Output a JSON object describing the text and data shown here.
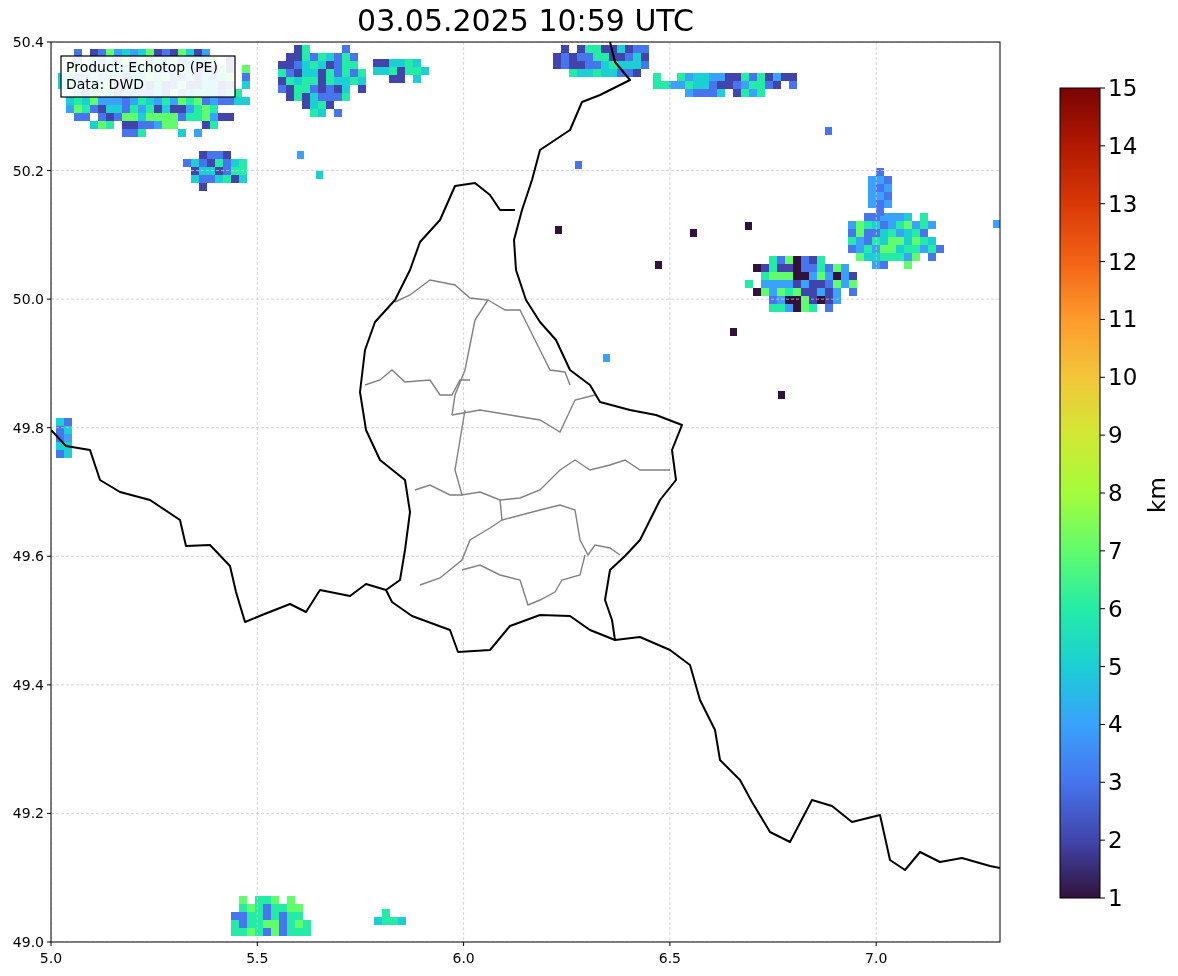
{
  "title": "03.05.2025 10:59 UTC",
  "info_box": {
    "lines": [
      "Product: Echotop (PE)",
      "Data: DWD"
    ]
  },
  "map": {
    "x_ticks": [
      "5.0",
      "5.5",
      "6.0",
      "6.5",
      "7.0"
    ],
    "y_ticks": [
      "50.4",
      "50.2",
      "50.0",
      "49.8",
      "49.6",
      "49.4",
      "49.2",
      "49.0"
    ]
  },
  "colorbar": {
    "label": "km",
    "ticks": [
      "15",
      "14",
      "13",
      "12",
      "11",
      "10",
      "9",
      "8",
      "7",
      "6",
      "5",
      "4",
      "3",
      "2",
      "1"
    ]
  }
}
